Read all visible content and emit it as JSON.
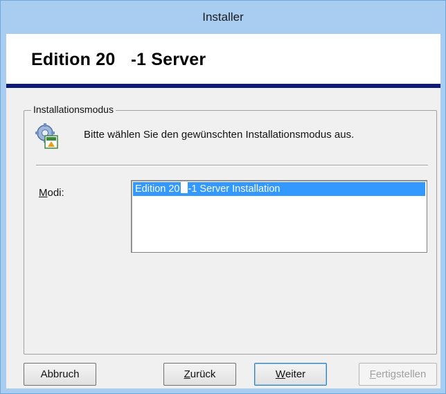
{
  "window": {
    "title": "Installer"
  },
  "header": {
    "title_part1": "Edition 20",
    "title_part2": "-1 Server"
  },
  "group": {
    "label": "Installationsmodus",
    "icon": "setup-gear-icon",
    "description": "Bitte wählen Sie den gewünschten Installationsmodus aus."
  },
  "modes": {
    "label_mnemonic": "M",
    "label_rest": "odi:",
    "selected_item_part1": "Edition 20",
    "selected_item_part2": "-1 Server Installation"
  },
  "buttons": {
    "cancel_label": "Abbruch",
    "back_mnemonic": "Z",
    "back_rest": "urück",
    "next_mnemonic": "W",
    "next_rest": "eiter",
    "finish_mnemonic": "F",
    "finish_rest": "ertigstellen"
  },
  "colors": {
    "header_rule": "#0c1a78",
    "selection": "#3399ff",
    "titlebar": "#a8cdf0"
  }
}
